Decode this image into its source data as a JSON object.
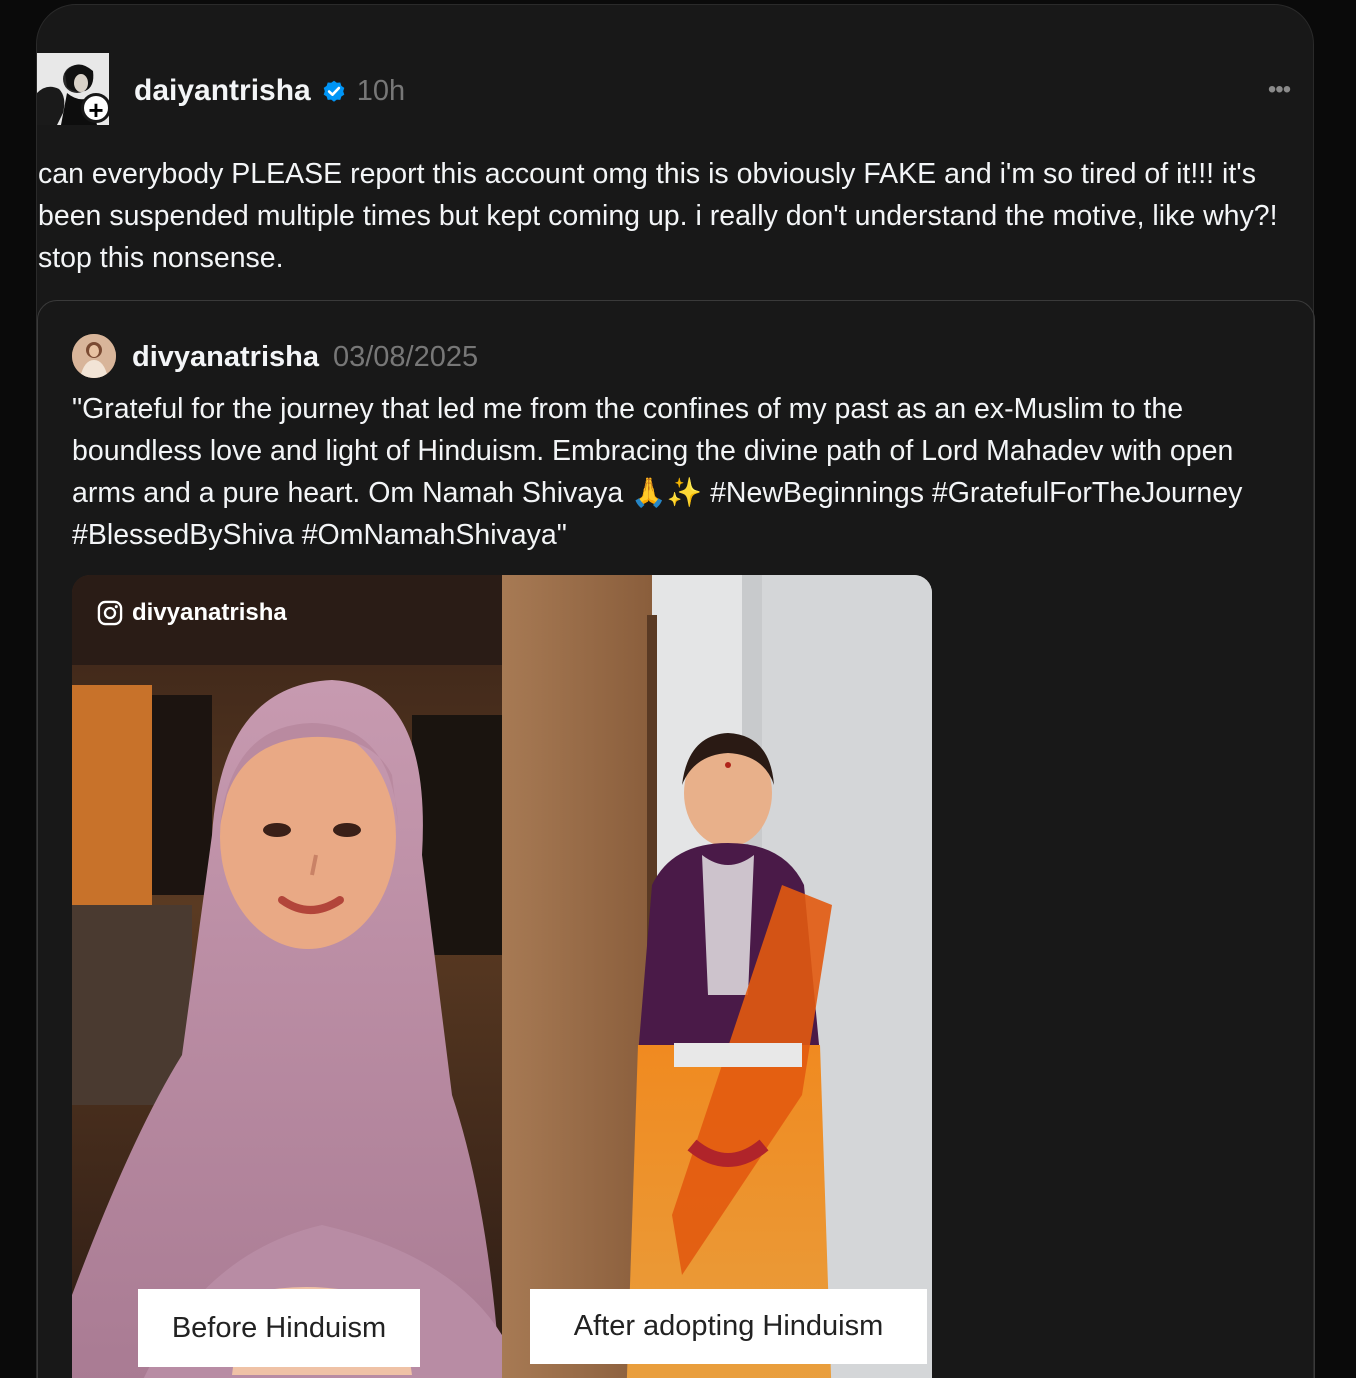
{
  "post": {
    "author": "daiyantrisha",
    "time": "10h",
    "text": "can everybody PLEASE report this account omg this is obviously FAKE and i'm so tired of it!!! it's been suspended multiple times but kept coming up. i really don't understand the motive, like why?! stop this nonsense.",
    "follow_glyph": "+",
    "more_glyph": "•••"
  },
  "quoted_post": {
    "author": "divyanatrisha",
    "date": "03/08/2025",
    "text": "\"Grateful for the journey that led me from the confines of my past as an ex-Muslim to the boundless love and light of Hinduism. Embracing the divine path of Lord Mahadev with open arms and a pure heart. Om Namah Shivaya 🙏✨ #NewBeginnings #GratefulForTheJourney #BlessedByShiva #OmNamahShivaya\"",
    "media": {
      "watermark_handle": "divyanatrisha",
      "caption_left": "Before Hinduism",
      "caption_right": "After adopting Hinduism"
    }
  },
  "colors": {
    "card_bg": "#181818",
    "text_primary": "#f3f5f7",
    "text_secondary": "#777777",
    "verified_blue": "#0095f6"
  },
  "icons": {
    "verified": "verified-badge-icon",
    "more": "more-horizontal-icon",
    "instagram": "instagram-icon",
    "follow": "plus-icon"
  }
}
